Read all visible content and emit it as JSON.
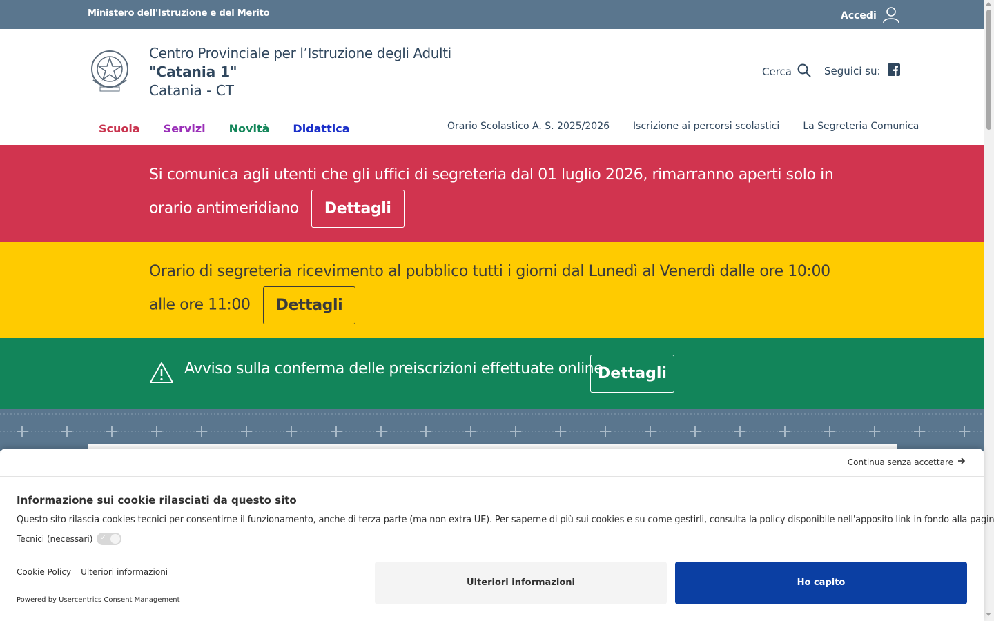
{
  "topbar": {
    "ministry": "Ministero dell'Istruzione e del Merito",
    "login_label": "Accedi"
  },
  "header": {
    "title_line1": "Centro Provinciale per l’Istruzione degli Adulti",
    "title_line2": "\"Catania 1\"",
    "title_line3": "Catania - CT",
    "search_label": "Cerca",
    "social_label": "Seguici su:"
  },
  "main_nav": [
    "Scuola",
    "Servizi",
    "Novità",
    "Didattica"
  ],
  "secondary_nav": [
    "Orario Scolastico A. S. 2025/2026",
    "Iscrizione ai percorsi scolastici",
    "La Segreteria Comunica"
  ],
  "banners": {
    "red": {
      "text": "Si comunica agli utenti che gli uffici di segreteria dal 01 luglio 2026, rimarranno aperti solo in orario antimeridiano",
      "button": "Dettagli"
    },
    "yellow": {
      "text": "Orario di segreteria ricevimento al pubblico tutti i giorni dal Lunedì al Venerdì dalle ore 10:00 alle ore 11:00",
      "button": "Dettagli"
    },
    "green": {
      "text": "Avviso sulla conferma delle preiscrizioni effettuate online",
      "button": "Dettagli"
    }
  },
  "cookie": {
    "continue": "Continua senza accettare",
    "title": "Informazione sui cookie rilasciati da questo sito",
    "description": "Questo sito rilascia cookies tecnici per consentirne il funzionamento, anche di terza parte (ma non extra UE). Per saperne di più sui cookies e su come gestirli, consulta la policy disponibile nell'apposito link in fondo alla pagina.",
    "toggle_label": "Tecnici (necessari)",
    "link_policy": "Cookie Policy",
    "link_more": "Ulteriori informazioni",
    "powered": "Powered by Usercentrics Consent Management",
    "btn_more": "Ulteriori informazioni",
    "btn_ok": "Ho capito"
  },
  "colors": {
    "topbar": "#5a768e",
    "red_banner": "#d1344f",
    "yellow_banner": "#ffcb00",
    "green_banner": "#12855a",
    "primary_button": "#0b3fa3"
  },
  "icons": [
    "user-icon",
    "emblem-icon",
    "search-icon",
    "facebook-icon",
    "warning-icon",
    "arrow-right-icon",
    "check-icon"
  ]
}
